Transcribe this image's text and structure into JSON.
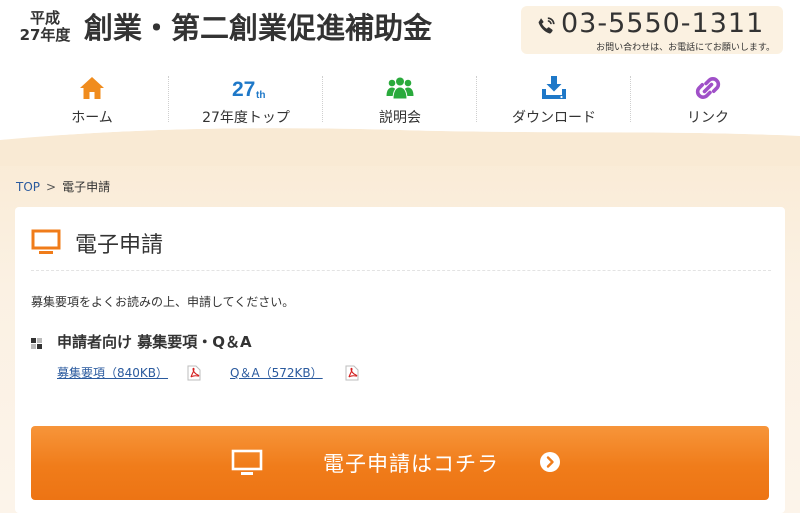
{
  "header": {
    "year_line1": "平成",
    "year_line2": "27年度",
    "title": "創業・第二創業促進補助金",
    "tel_number": "03-5550-1311",
    "tel_note": "お問い合わせは、お電話にてお願いします。"
  },
  "nav": {
    "items": [
      {
        "label": "ホーム",
        "icon": "home-icon",
        "color": "#f08c1e"
      },
      {
        "label": "27年度トップ",
        "icon": "27th-icon",
        "icon_text": "27",
        "icon_sup": "th",
        "color": "#1e78c8"
      },
      {
        "label": "説明会",
        "icon": "people-icon",
        "color": "#2aaa3c"
      },
      {
        "label": "ダウンロード",
        "icon": "download-icon",
        "color": "#1e78c8"
      },
      {
        "label": "リンク",
        "icon": "link-icon",
        "color": "#a050c8"
      }
    ]
  },
  "breadcrumb": {
    "top": "TOP",
    "separator": ">",
    "current": "電子申請"
  },
  "panel": {
    "title": "電子申請",
    "lead": "募集要項をよくお読みの上、申請してください。",
    "sub_title": "申請者向け 募集要項・Q＆A",
    "links": [
      {
        "label": "募集要項（840KB）"
      },
      {
        "label": "Q＆A（572KB）"
      }
    ],
    "cta_label": "電子申請はコチラ"
  },
  "colors": {
    "accent_orange": "#f07c1a",
    "link_blue": "#2a5a9e",
    "band": "#fbf1e3",
    "pdf_red": "#d42020"
  }
}
